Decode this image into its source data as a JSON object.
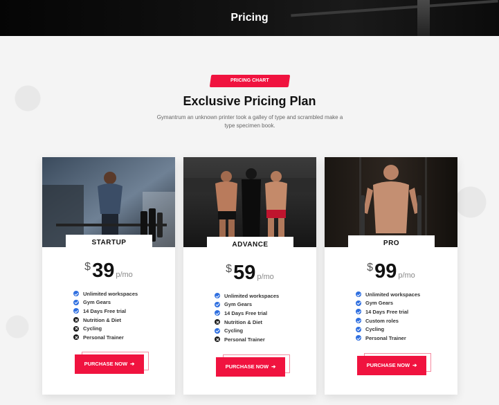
{
  "header": {
    "title": "Pricing"
  },
  "section": {
    "badge": "PRICING CHART",
    "title": "Exclusive Pricing Plan",
    "subtitle": "Gymantrum an unknown printer took a galley of type and scrambled make a type specimen book."
  },
  "plans": [
    {
      "name": "STARTUP",
      "currency": "$",
      "price": "39",
      "period": "p/mo",
      "features": [
        {
          "label": "Unlimited workspaces",
          "included": true
        },
        {
          "label": "Gym Gears",
          "included": true
        },
        {
          "label": "14 Days Free trial",
          "included": true
        },
        {
          "label": "Nutrition & Diet",
          "included": false
        },
        {
          "label": "Cycling",
          "included": false
        },
        {
          "label": "Personal Trainer",
          "included": false
        }
      ],
      "button": "PURCHASE NOW",
      "button_icon": "arrow-right-icon"
    },
    {
      "name": "ADVANCE",
      "currency": "$",
      "price": "59",
      "period": "p/mo",
      "features": [
        {
          "label": "Unlimited workspaces",
          "included": true
        },
        {
          "label": "Gym Gears",
          "included": true
        },
        {
          "label": "14 Days Free trial",
          "included": true
        },
        {
          "label": "Nutrition & Diet",
          "included": false
        },
        {
          "label": "Cycling",
          "included": true
        },
        {
          "label": "Personal Trainer",
          "included": false
        }
      ],
      "button": "PURCHASE NOW",
      "button_icon": "arrow-right-icon"
    },
    {
      "name": "PRO",
      "currency": "$",
      "price": "99",
      "period": "p/mo",
      "features": [
        {
          "label": "Unlimited workspaces",
          "included": true
        },
        {
          "label": "Gym Gears",
          "included": true
        },
        {
          "label": "14 Days Free trial",
          "included": true
        },
        {
          "label": "Custom roles",
          "included": true
        },
        {
          "label": "Cycling",
          "included": true
        },
        {
          "label": "Personal Trainer",
          "included": true
        }
      ],
      "button": "PURCHASE NOW",
      "button_icon": "arrow-right-icon"
    }
  ],
  "colors": {
    "accent": "#f0133f",
    "check": "#2f6fe0",
    "cross": "#1a1a1a"
  }
}
